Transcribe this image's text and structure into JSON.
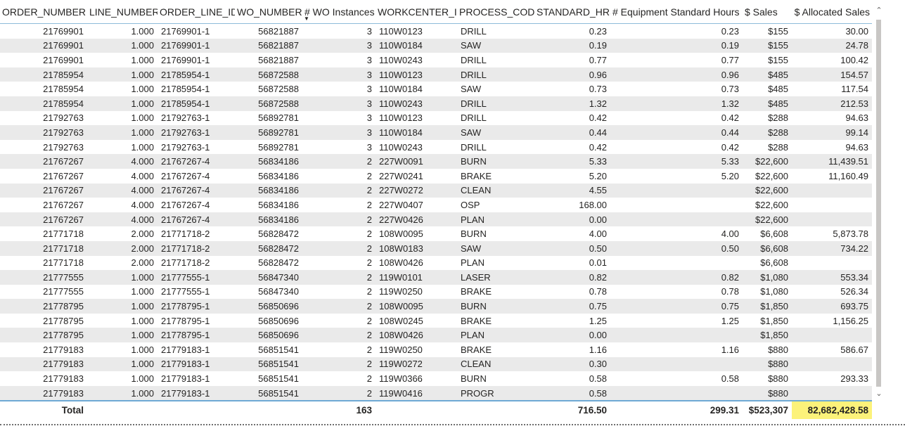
{
  "headers": [
    "ORDER_NUMBER",
    "LINE_NUMBER",
    "ORDER_LINE_ID",
    "WO_NUMBER",
    "# WO Instances",
    "WORKCENTER_ID",
    "PROCESS_CODE",
    "STANDARD_HRS",
    "# Equipment Standard Hours",
    "$ Sales",
    "$ Allocated Sales"
  ],
  "rows": [
    [
      "21769901",
      "1.000",
      "21769901-1",
      "56821887",
      "3",
      "110W0123",
      "DRILL",
      "0.23",
      "0.23",
      "$155",
      "30.00"
    ],
    [
      "21769901",
      "1.000",
      "21769901-1",
      "56821887",
      "3",
      "110W0184",
      "SAW",
      "0.19",
      "0.19",
      "$155",
      "24.78"
    ],
    [
      "21769901",
      "1.000",
      "21769901-1",
      "56821887",
      "3",
      "110W0243",
      "DRILL",
      "0.77",
      "0.77",
      "$155",
      "100.42"
    ],
    [
      "21785954",
      "1.000",
      "21785954-1",
      "56872588",
      "3",
      "110W0123",
      "DRILL",
      "0.96",
      "0.96",
      "$485",
      "154.57"
    ],
    [
      "21785954",
      "1.000",
      "21785954-1",
      "56872588",
      "3",
      "110W0184",
      "SAW",
      "0.73",
      "0.73",
      "$485",
      "117.54"
    ],
    [
      "21785954",
      "1.000",
      "21785954-1",
      "56872588",
      "3",
      "110W0243",
      "DRILL",
      "1.32",
      "1.32",
      "$485",
      "212.53"
    ],
    [
      "21792763",
      "1.000",
      "21792763-1",
      "56892781",
      "3",
      "110W0123",
      "DRILL",
      "0.42",
      "0.42",
      "$288",
      "94.63"
    ],
    [
      "21792763",
      "1.000",
      "21792763-1",
      "56892781",
      "3",
      "110W0184",
      "SAW",
      "0.44",
      "0.44",
      "$288",
      "99.14"
    ],
    [
      "21792763",
      "1.000",
      "21792763-1",
      "56892781",
      "3",
      "110W0243",
      "DRILL",
      "0.42",
      "0.42",
      "$288",
      "94.63"
    ],
    [
      "21767267",
      "4.000",
      "21767267-4",
      "56834186",
      "2",
      "227W0091",
      "BURN",
      "5.33",
      "5.33",
      "$22,600",
      "11,439.51"
    ],
    [
      "21767267",
      "4.000",
      "21767267-4",
      "56834186",
      "2",
      "227W0241",
      "BRAKE",
      "5.20",
      "5.20",
      "$22,600",
      "11,160.49"
    ],
    [
      "21767267",
      "4.000",
      "21767267-4",
      "56834186",
      "2",
      "227W0272",
      "CLEAN",
      "4.55",
      "",
      "$22,600",
      ""
    ],
    [
      "21767267",
      "4.000",
      "21767267-4",
      "56834186",
      "2",
      "227W0407",
      "OSP",
      "168.00",
      "",
      "$22,600",
      ""
    ],
    [
      "21767267",
      "4.000",
      "21767267-4",
      "56834186",
      "2",
      "227W0426",
      "PLAN",
      "0.00",
      "",
      "$22,600",
      ""
    ],
    [
      "21771718",
      "2.000",
      "21771718-2",
      "56828472",
      "2",
      "108W0095",
      "BURN",
      "4.00",
      "4.00",
      "$6,608",
      "5,873.78"
    ],
    [
      "21771718",
      "2.000",
      "21771718-2",
      "56828472",
      "2",
      "108W0183",
      "SAW",
      "0.50",
      "0.50",
      "$6,608",
      "734.22"
    ],
    [
      "21771718",
      "2.000",
      "21771718-2",
      "56828472",
      "2",
      "108W0426",
      "PLAN",
      "0.01",
      "",
      "$6,608",
      ""
    ],
    [
      "21777555",
      "1.000",
      "21777555-1",
      "56847340",
      "2",
      "119W0101",
      "LASER",
      "0.82",
      "0.82",
      "$1,080",
      "553.34"
    ],
    [
      "21777555",
      "1.000",
      "21777555-1",
      "56847340",
      "2",
      "119W0250",
      "BRAKE",
      "0.78",
      "0.78",
      "$1,080",
      "526.34"
    ],
    [
      "21778795",
      "1.000",
      "21778795-1",
      "56850696",
      "2",
      "108W0095",
      "BURN",
      "0.75",
      "0.75",
      "$1,850",
      "693.75"
    ],
    [
      "21778795",
      "1.000",
      "21778795-1",
      "56850696",
      "2",
      "108W0245",
      "BRAKE",
      "1.25",
      "1.25",
      "$1,850",
      "1,156.25"
    ],
    [
      "21778795",
      "1.000",
      "21778795-1",
      "56850696",
      "2",
      "108W0426",
      "PLAN",
      "0.00",
      "",
      "$1,850",
      ""
    ],
    [
      "21779183",
      "1.000",
      "21779183-1",
      "56851541",
      "2",
      "119W0250",
      "BRAKE",
      "1.16",
      "1.16",
      "$880",
      "586.67"
    ],
    [
      "21779183",
      "1.000",
      "21779183-1",
      "56851541",
      "2",
      "119W0272",
      "CLEAN",
      "0.30",
      "",
      "$880",
      ""
    ],
    [
      "21779183",
      "1.000",
      "21779183-1",
      "56851541",
      "2",
      "119W0366",
      "BURN",
      "0.58",
      "0.58",
      "$880",
      "293.33"
    ],
    [
      "21779183",
      "1.000",
      "21779183-1",
      "56851541",
      "2",
      "119W0416",
      "PROGR",
      "0.58",
      "",
      "$880",
      ""
    ]
  ],
  "totals": {
    "label": "Total",
    "wo_instances": "163",
    "standard_hrs": "716.50",
    "equipment_hours": "299.31",
    "sales": "$523,307",
    "allocated_sales": "82,682,428.58"
  },
  "colors": {
    "highlight": "#fcf27a",
    "header_rule": "#8dbbd9",
    "band": "#eaeaea"
  },
  "icons": {
    "sort": "sort-descending-icon",
    "scroll_up": "chevron-up-icon",
    "scroll_down": "chevron-down-icon"
  }
}
